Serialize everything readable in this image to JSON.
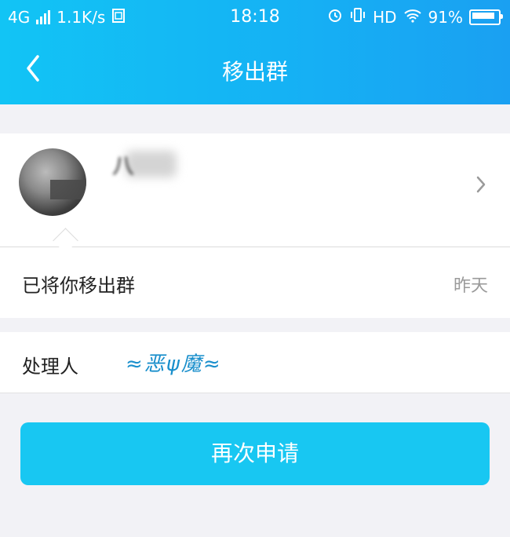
{
  "status_bar": {
    "network": "4G",
    "speed": "1.1K/s",
    "time": "18:18",
    "hd": "HD",
    "battery": "91%"
  },
  "nav": {
    "title": "移出群"
  },
  "user": {
    "name": "八"
  },
  "message": {
    "text": "已将你移出群",
    "time": "昨天"
  },
  "handler": {
    "label": "处理人",
    "name": "≈恶ψ魔≈"
  },
  "action": {
    "reapply_label": "再次申请"
  },
  "colors": {
    "header": "#15b2f4",
    "button": "#18c7f2"
  }
}
